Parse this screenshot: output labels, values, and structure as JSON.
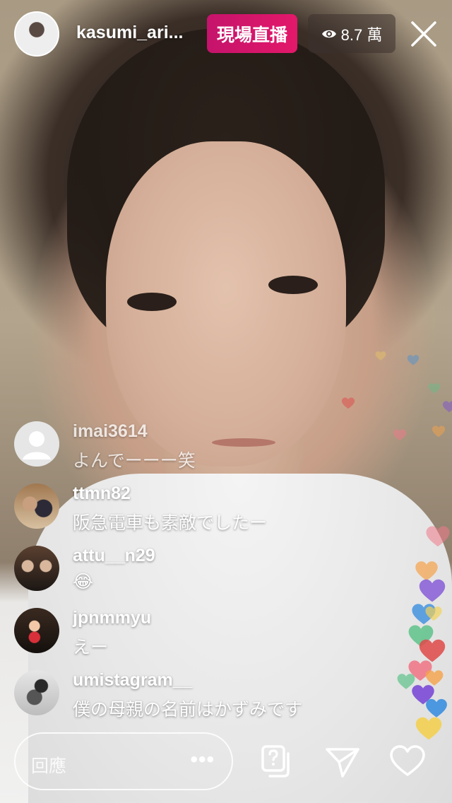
{
  "host": {
    "username": "kasumi_ari...",
    "live_label": "現場直播",
    "viewer_count": "8.7 萬"
  },
  "comments": [
    {
      "username": "imai3614",
      "text": "よんでーーー笑"
    },
    {
      "username": "ttmn82",
      "text": "阪急電車も素敵でしたー"
    },
    {
      "username": "attu__n29",
      "text": "😂"
    },
    {
      "username": "jpnmmyu",
      "text": "えー"
    },
    {
      "username": "umistagram__",
      "text": "僕の母親の名前はかずみです"
    }
  ],
  "reply": {
    "placeholder": "回應",
    "more": "•••"
  },
  "icons": {
    "close": "close-icon",
    "viewers": "eye-icon",
    "question": "question-box-icon",
    "send": "paper-plane-icon",
    "like": "heart-icon"
  },
  "colors": {
    "live_badge": "#d8146a",
    "heart_colors": [
      "#f07a8a",
      "#f6a34a",
      "#7b4bd6",
      "#3b8fe0",
      "#f2d25a",
      "#5ec38a",
      "#e04a4a"
    ]
  }
}
